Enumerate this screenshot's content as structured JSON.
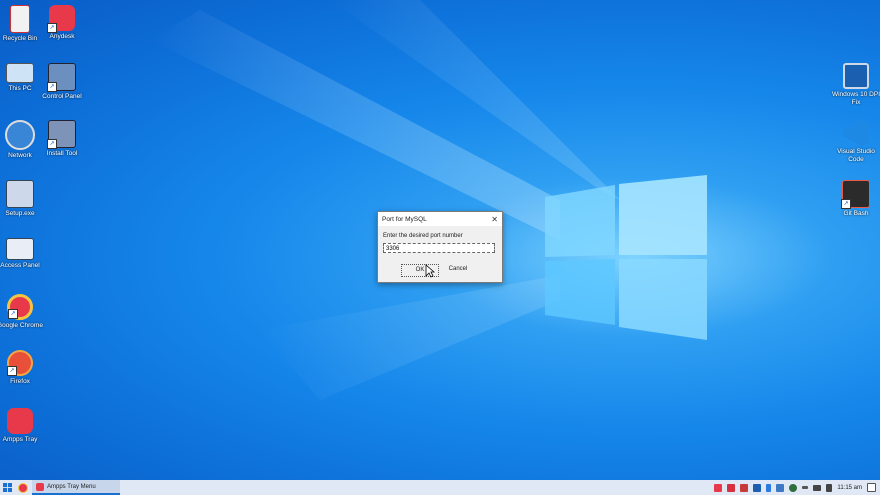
{
  "desktop": {
    "left_icons": [
      {
        "label": "Recycle Bin",
        "icon": "recycle-bin-icon"
      },
      {
        "label": "Anydesk",
        "icon": "anydesk-icon"
      },
      {
        "label": "This PC",
        "icon": "this-pc-icon"
      },
      {
        "label": "Control Panel",
        "icon": "control-panel-icon"
      },
      {
        "label": "Network",
        "icon": "network-icon"
      },
      {
        "label": "Install Tool",
        "icon": "installer-icon"
      },
      {
        "label": "Setup.exe",
        "icon": "setup-icon"
      },
      {
        "label": "Access Panel",
        "icon": "access-panel-icon"
      },
      {
        "label": "Google Chrome",
        "icon": "chrome-icon"
      },
      {
        "label": "Firefox",
        "icon": "firefox-icon"
      },
      {
        "label": "Ampps Tray",
        "icon": "ampps-icon"
      }
    ],
    "right_icons": [
      {
        "label": "Windows 10 DPI Fix",
        "icon": "dpi-fix-icon"
      },
      {
        "label": "Visual Studio Code",
        "icon": "vscode-icon"
      },
      {
        "label": "Git Bash",
        "icon": "git-bash-icon"
      }
    ]
  },
  "dialog": {
    "title": "Port for MySQL",
    "close_glyph": "✕",
    "prompt": "Enter the desired port number",
    "input_value": "3306",
    "ok_label": "OK",
    "cancel_label": "Cancel"
  },
  "taskbar": {
    "active_app": "Ampps Tray Menu",
    "clock": "11:15 am",
    "colors": {
      "accent": "#1a6fd0",
      "ampps": "#e8394a"
    }
  }
}
